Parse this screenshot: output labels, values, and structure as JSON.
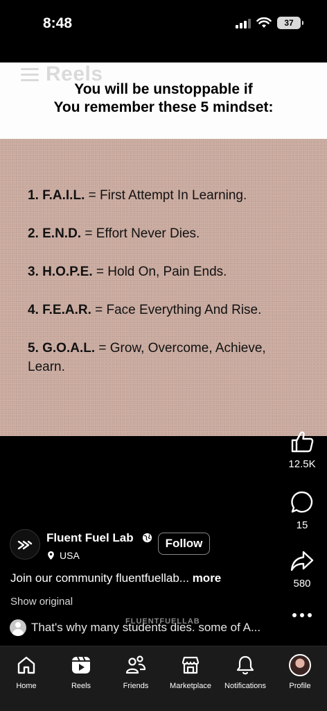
{
  "status_bar": {
    "time": "8:48",
    "battery": "37"
  },
  "reel": {
    "overlay_title": "Reels",
    "headline_line1": "You will be unstoppable if",
    "headline_line2": "You remember these 5 mindset:",
    "mindsets": [
      {
        "code": "1. F.A.I.L.",
        "meaning": " = First Attempt In Learning."
      },
      {
        "code": "2. E.N.D.",
        "meaning": " = Effort Never Dies."
      },
      {
        "code": "3. H.O.P.E.",
        "meaning": " = Hold On, Pain Ends."
      },
      {
        "code": "4. F.E.A.R.",
        "meaning": " = Face Everything And Rise."
      },
      {
        "code": "5. G.O.A.L.",
        "meaning": " = Grow, Overcome, Achieve, Learn."
      }
    ]
  },
  "actions": {
    "likes": "12.5K",
    "comments": "15",
    "shares": "580"
  },
  "author": {
    "name": "Fluent Fuel Lab",
    "location": "USA",
    "follow_label": "Follow"
  },
  "caption": {
    "text": "Join our community fluentfuellab... ",
    "more": "more"
  },
  "show_original": "Show original",
  "watermark": "FLUENTFUELLAB",
  "comment_preview": "That's why many students dies. some of A...",
  "tabs": [
    {
      "label": "Home",
      "icon": "home-icon"
    },
    {
      "label": "Reels",
      "icon": "reels-icon"
    },
    {
      "label": "Friends",
      "icon": "friends-icon"
    },
    {
      "label": "Marketplace",
      "icon": "marketplace-icon"
    },
    {
      "label": "Notifications",
      "icon": "bell-icon"
    },
    {
      "label": "Profile",
      "icon": "profile-avatar"
    }
  ],
  "colors": {
    "video_background": "#c8a89d",
    "tab_bar": "#1b1b1b",
    "header": "#fdfdfd"
  }
}
